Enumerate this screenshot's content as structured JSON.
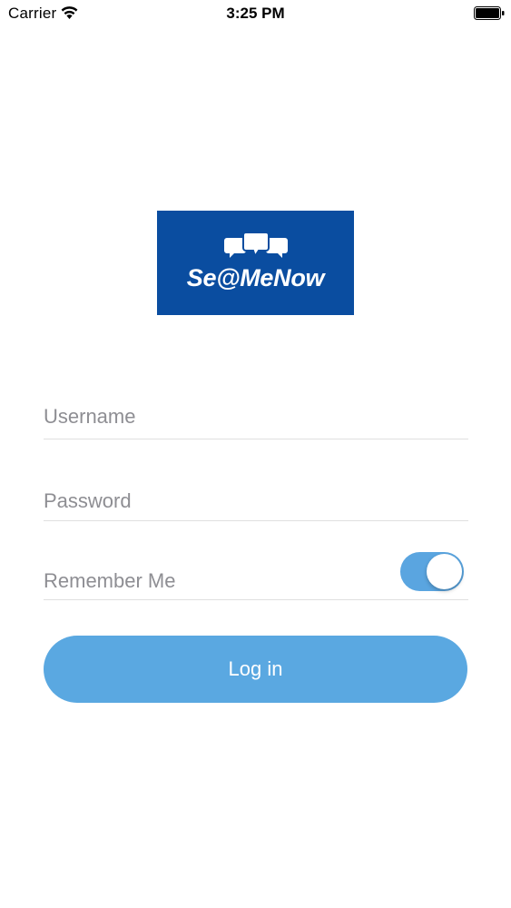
{
  "status_bar": {
    "carrier": "Carrier",
    "time": "3:25 PM",
    "wifi_icon": "wifi-icon",
    "battery_icon": "battery-full-icon"
  },
  "logo": {
    "text": "Se@MeNow",
    "background_color": "#0a4da0",
    "icon": "chat-bubbles-icon"
  },
  "form": {
    "username": {
      "placeholder": "Username",
      "value": ""
    },
    "password": {
      "placeholder": "Password",
      "value": ""
    },
    "remember_me": {
      "label": "Remember Me",
      "on": true,
      "on_color": "#5aa5e0"
    },
    "login_button": {
      "label": "Log in",
      "color": "#5aa8e1"
    }
  }
}
